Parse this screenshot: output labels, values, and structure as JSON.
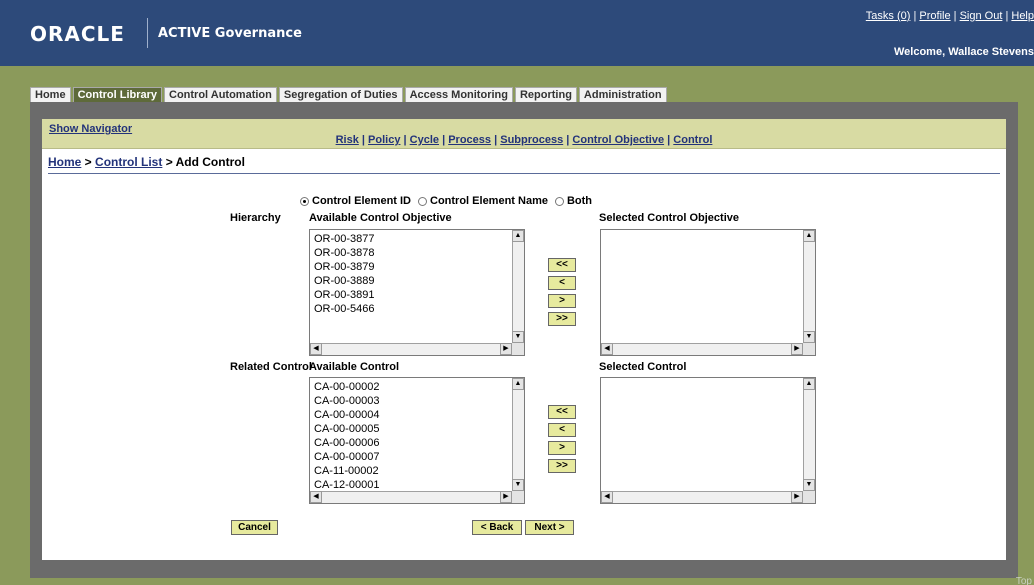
{
  "header": {
    "logo": "ORACLE",
    "product": "ACTIVE Governance",
    "links": [
      "Tasks (0)",
      "Profile",
      "Sign Out",
      "Help"
    ],
    "welcome": "Welcome, Wallace Stevens"
  },
  "tabs": [
    "Home",
    "Control Library",
    "Control Automation",
    "Segregation of Duties",
    "Access Monitoring",
    "Reporting",
    "Administration"
  ],
  "navbar": {
    "show_navigator": "Show Navigator",
    "crumbs": [
      "Risk",
      "Policy",
      "Cycle",
      "Process",
      "Subprocess",
      "Control Objective",
      "Control"
    ]
  },
  "page": {
    "crumb_home": "Home",
    "crumb_list": "Control List",
    "crumb_current": "Add Control"
  },
  "radio": {
    "options": [
      "Control Element ID",
      "Control Element Name",
      "Both"
    ],
    "selected": "Control Element ID"
  },
  "hierarchy": {
    "label": "Hierarchy",
    "available_label": "Available Control Objective",
    "selected_label": "Selected Control Objective",
    "available": [
      "OR-00-3877",
      "OR-00-3878",
      "OR-00-3879",
      "OR-00-3889",
      "OR-00-3891",
      "OR-00-5466"
    ],
    "selected": []
  },
  "related": {
    "label": "Related Control",
    "available_label": "Available Control",
    "selected_label": "Selected Control",
    "available": [
      "CA-00-00002",
      "CA-00-00003",
      "CA-00-00004",
      "CA-00-00005",
      "CA-00-00006",
      "CA-00-00007",
      "CA-11-00002",
      "CA-12-00001"
    ],
    "selected": []
  },
  "move_buttons": [
    "<<",
    "<",
    ">",
    ">>"
  ],
  "actions": {
    "cancel": "Cancel",
    "back": "< Back",
    "next": "Next >"
  },
  "footer": {
    "top": "Top"
  }
}
